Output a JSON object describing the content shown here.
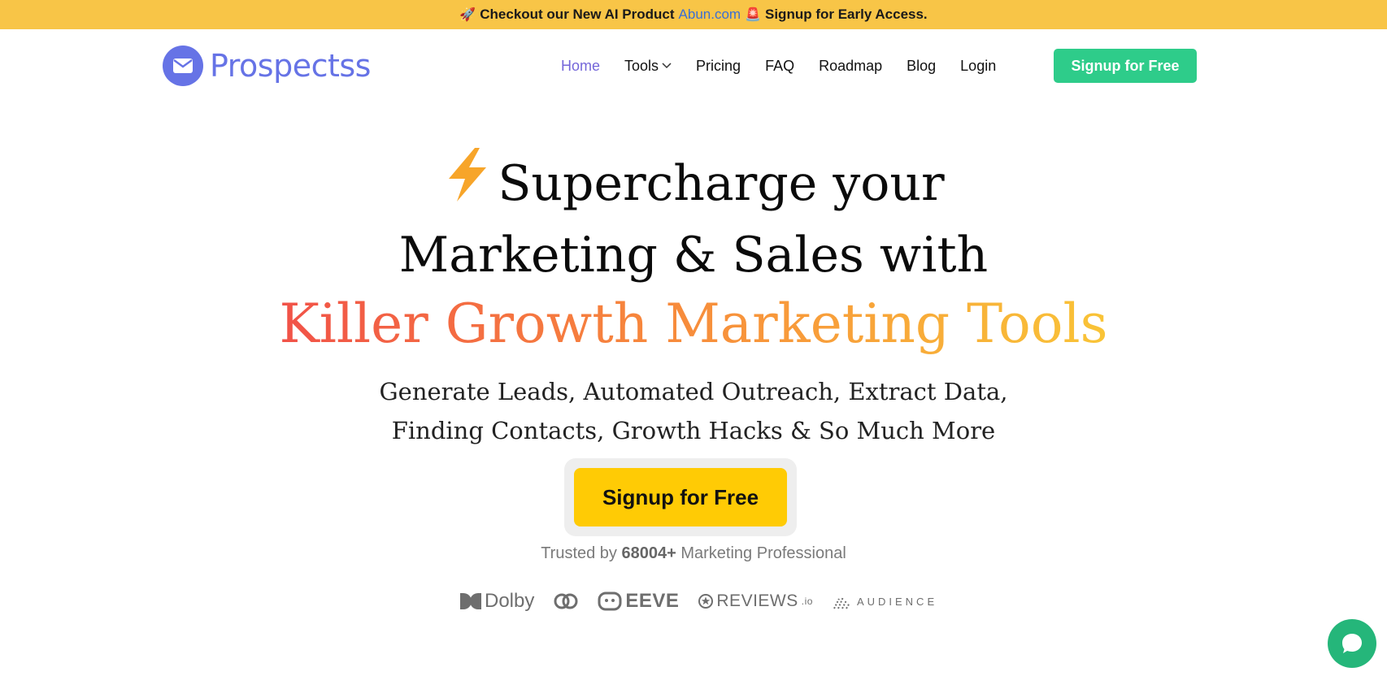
{
  "announcement": {
    "rocket": "🚀",
    "text_before": "Checkout our New AI Product",
    "link": "Abun.com",
    "siren": "🚨",
    "text_after": "Signup for Early Access."
  },
  "brand": {
    "name": "Prospectss",
    "color": "#6673e6"
  },
  "nav": {
    "items": [
      {
        "label": "Home",
        "active": true
      },
      {
        "label": "Tools",
        "dropdown": true
      },
      {
        "label": "Pricing"
      },
      {
        "label": "FAQ"
      },
      {
        "label": "Roadmap"
      },
      {
        "label": "Blog"
      },
      {
        "label": "Login"
      }
    ],
    "cta": "Signup for Free",
    "cta_color": "#2ecc8a"
  },
  "hero": {
    "line1": "Supercharge your",
    "line2": "Marketing & Sales with",
    "line3": "Killer Growth Marketing Tools",
    "sub1": "Generate Leads, Automated Outreach, Extract Data,",
    "sub2": "Finding Contacts, Growth Hacks & So Much More",
    "cta": "Signup for Free",
    "cta_color": "#ffcb05",
    "trusted_prefix": "Trusted by",
    "trusted_count": "68004+",
    "trusted_suffix": "Marketing Professional"
  },
  "partner_logos": {
    "dolby": "Dolby",
    "eeve": "EEVE",
    "reviews": "REVIEWS",
    "reviews_suffix": ".io",
    "audience": "AUDIENCE"
  },
  "icons": {
    "logo": "envelope-icon",
    "bolt": "lightning-bolt-icon",
    "chat": "chat-bubble-icon"
  }
}
